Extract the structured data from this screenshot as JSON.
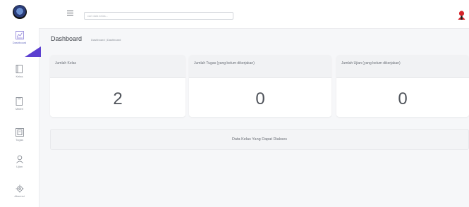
{
  "sidebar": {
    "items": [
      {
        "label": "Dashboard",
        "icon": "chart-icon"
      },
      {
        "label": "Kelas",
        "icon": "book-icon"
      },
      {
        "label": "Materi",
        "icon": "document-icon"
      },
      {
        "label": "Tugas",
        "icon": "assignment-icon"
      },
      {
        "label": "Ujian",
        "icon": "user-icon"
      },
      {
        "label": "Absensi",
        "icon": "gear-icon"
      }
    ]
  },
  "topbar": {
    "search_placeholder": "cari data kelas..."
  },
  "page": {
    "title": "Dashboard",
    "breadcrumb": "Dashboard |  Dashboard"
  },
  "cards": [
    {
      "title": "Jumlah Kelas",
      "value": "2"
    },
    {
      "title": "Jumlah Tugas (yang belum dikerjakan)",
      "value": "0"
    },
    {
      "title": "Jumlah Ujian (yang belum dikerjakan)",
      "value": "0"
    }
  ],
  "banner": {
    "text": "Data Kelas Yang Dapat Diakses"
  },
  "colors": {
    "accent": "#5b3fd0",
    "avatar": "#d6232a"
  }
}
